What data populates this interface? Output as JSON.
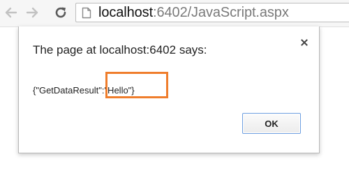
{
  "browser": {
    "url_host": "localhost",
    "url_rest": ":6402/JavaScript.aspx",
    "icons": {
      "back": "arrow-left",
      "forward": "arrow-right",
      "reload": "reload",
      "page": "page-document"
    }
  },
  "dialog": {
    "title": "The page at localhost:6402 says:",
    "message": "{\"GetDataResult\":\"Hello\"}",
    "ok_label": "OK",
    "close_icon": "close-x",
    "highlight_color": "#ef7d2c"
  }
}
